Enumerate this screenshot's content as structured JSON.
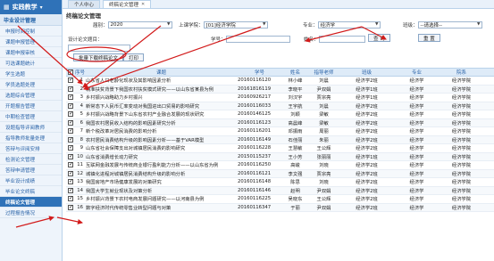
{
  "sidebar": {
    "brand": "实践教学",
    "section": "毕业设计管理",
    "items": [
      "申报时间控制",
      "课题申报管理",
      "课题申报审核",
      "可选课题统计",
      "学生选题",
      "学员选题处理",
      "选题综合管理",
      "开题报告管理",
      "中期检查管理",
      "设题指导评阅教师",
      "指导教师批量处理",
      "答辩与评阅安排",
      "检测论文管理",
      "答辩申请管理",
      "毕业设计成绩",
      "毕业论文终稿",
      "终稿论文管理",
      "过程报告情况"
    ],
    "active_index": 16
  },
  "tabs": [
    {
      "label": "个人中心",
      "active": false
    },
    {
      "label": "终稿论文管理",
      "active": true
    }
  ],
  "panel_title": "终稿论文管理",
  "filters": {
    "year_label": "届别：",
    "year_value": "2020",
    "dept_label": "上课学院：",
    "dept_value": "[01]经济学院",
    "major_label": "专业：",
    "major_value": "经济学",
    "class_label": "班级：",
    "class_value": "--请选择--",
    "status_label": "设计论文题目：",
    "status_value": "",
    "stuid_label": "学号：",
    "stuid_value": "",
    "name_label": "姓名：",
    "name_value": "",
    "query_btn": "查 询",
    "reset_btn": "重 置",
    "batch_btn": "批量下载终稿论文",
    "print_btn": "打印"
  },
  "table": {
    "headers": [
      "序号",
      "课题",
      "学号",
      "姓名",
      "指导老师",
      "班级",
      "专业",
      "院系"
    ],
    "rows": [
      [
        "1",
        "山东省人口老龄化现状及其影响因素分析",
        "20160116120",
        "林小峰",
        "刘晨",
        "经济学2班",
        "经济学",
        "经济学院"
      ],
      [
        "2",
        "精准扶贫背景下我国农村扶贫模式研究——以山东省某县为例",
        "20161816119",
        "李晓平",
        "尹双娟",
        "经济学1班",
        "经济学",
        "经济学院"
      ],
      [
        "3",
        "乡村振兴战略助力乡村振兴",
        "20160926217",
        "刘汉宇",
        "贾宗亮",
        "经济学1班",
        "经济学",
        "经济学院"
      ],
      [
        "4",
        "新常态下人民币汇率变动对我国进出口贸易的影响研究",
        "20160116033",
        "王宇航",
        "刘晨",
        "经济学2班",
        "经济学",
        "经济学院"
      ],
      [
        "5",
        "乡村振兴战略背景下山东省农村产业融合发展的现状研究",
        "20160146125",
        "刘颖",
        "梁敏",
        "经济学2班",
        "经济学",
        "经济学院"
      ],
      [
        "6",
        "我国农村居民收入结构的影响因素研究分析",
        "20160116123",
        "高晨峰",
        "梁敏",
        "经济学2班",
        "经济学",
        "经济学院"
      ],
      [
        "7",
        "新个税改革对居民消费的影响分析",
        "20160116201",
        "邓振雨",
        "周丽",
        "经济学2班",
        "经济学",
        "经济学院"
      ],
      [
        "8",
        "农村居民消费结构升级的影响因素分析——基于VAR模型",
        "20160116149",
        "石佳丽",
        "朱丽",
        "经济学2班",
        "经济学",
        "经济学院"
      ],
      [
        "9",
        "山东省社会保障支出对城镇居民消费的影响研究",
        "20160116228",
        "王慧敏",
        "王公辉",
        "经济学2班",
        "经济学",
        "经济学院"
      ],
      [
        "10",
        "山东省消费增长动力研究",
        "20150115237",
        "王小芳",
        "张丽丽",
        "经济学1班",
        "经济学",
        "经济学院"
      ],
      [
        "11",
        "互联网金融发展与传统商业银行盈利能力分析——以山东省为例",
        "20160116250",
        "高峻",
        "刘晓",
        "经济学2班",
        "经济学",
        "经济学院"
      ],
      [
        "12",
        "城镇化进程对城镇居民消费结构升级的影响分析",
        "20160116121",
        "李文强",
        "贾宗亮",
        "经济学2班",
        "经济学",
        "经济学院"
      ],
      [
        "13",
        "我国房地产市场健康发展的对策研究",
        "20160116148",
        "陈思",
        "刘晓",
        "经济学2班",
        "经济学",
        "经济学院"
      ],
      [
        "14",
        "我国大学生就业现状及对策分析",
        "20160116146",
        "赵明",
        "尹双娟",
        "经济学2班",
        "经济学",
        "经济学院"
      ],
      [
        "15",
        "乡村振兴背景下农村电商发展问题研究——以河南县为例",
        "20160116225",
        "吴晓东",
        "王公辉",
        "经济学2班",
        "经济学",
        "经济学院"
      ],
      [
        "16",
        "数字经济时代传统零售业转型问题与对策",
        "20160116347",
        "于丽",
        "尹双娟",
        "经济学2班",
        "经济学",
        "经济学院"
      ]
    ]
  },
  "colors": {
    "brand": "#2f72b8",
    "annotation": "#d21a1a"
  }
}
